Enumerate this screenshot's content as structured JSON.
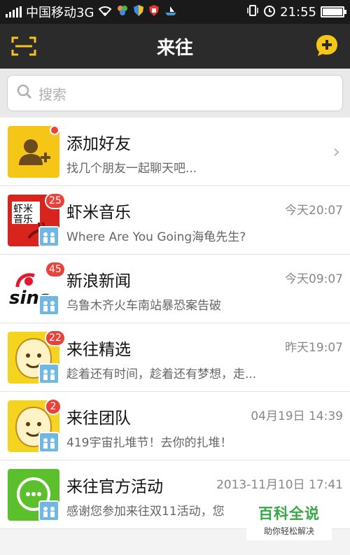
{
  "status_bar": {
    "carrier": "中国移动3G",
    "time": "21:55",
    "battery_level": 1.0
  },
  "nav": {
    "title": "来往",
    "left_icon": "scan-icon",
    "right_icon": "chat-add-icon"
  },
  "search": {
    "placeholder": "搜索"
  },
  "colors": {
    "accent_yellow": "#f5c518",
    "badge_red": "#e8423b",
    "nav_bg": "#2b2b2b"
  },
  "conversations": [
    {
      "title": "添加好友",
      "subtitle": "找几个朋友一起聊天吧...",
      "time": "",
      "badge": "",
      "avatar": "add-friend-icon"
    },
    {
      "title": "虾米音乐",
      "subtitle": "Where Are You Going海龟先生?",
      "time": "今天20:07",
      "badge": "25",
      "avatar": "xiami-logo",
      "avatar_text": "虾米\n音乐"
    },
    {
      "title": "新浪新闻",
      "subtitle": "乌鲁木齐火车南站暴恐案告破",
      "time": "今天09:07",
      "badge": "45",
      "avatar": "sina-logo",
      "avatar_text": "sina"
    },
    {
      "title": "来往精选",
      "subtitle": "趁着还有时间，趁着还有梦想，走...",
      "time": "昨天19:07",
      "badge": "22",
      "avatar": "laiwang-face-icon"
    },
    {
      "title": "来往团队",
      "subtitle": "419宇宙扎堆节！去你的扎堆！",
      "time": "04月19日 14:39",
      "badge": "2",
      "avatar": "laiwang-face-icon"
    },
    {
      "title": "来往官方活动",
      "subtitle": "感谢您参加来往双11活动，您",
      "time": "2013-11月10日 17:41",
      "badge": "",
      "avatar": "chat-bubble-icon"
    }
  ],
  "watermark": {
    "main": "百科全说",
    "sub": "助你轻松解决"
  }
}
